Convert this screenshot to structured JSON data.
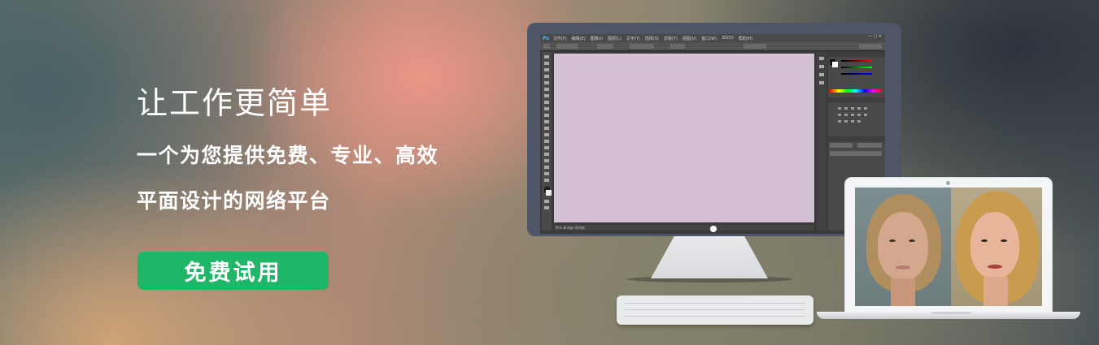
{
  "hero": {
    "headline": "让工作更简单",
    "subline1": "一个为您提供免费、专业、高效",
    "subline2": "平面设计的网络平台",
    "cta_label": "免费试用"
  },
  "colors": {
    "cta": "#1fb767",
    "monitor_bezel": "#4d5567",
    "canvas": "#d4c2d4"
  },
  "photoshop": {
    "logo": "Ps",
    "menu": [
      "文件(F)",
      "编辑(E)",
      "图像(I)",
      "图层(L)",
      "文字(Y)",
      "选择(S)",
      "滤镜(T)",
      "视图(V)",
      "窗口(W)",
      "3D(D)",
      "帮助(H)"
    ],
    "status": "Mini Bridge  时间轴"
  }
}
